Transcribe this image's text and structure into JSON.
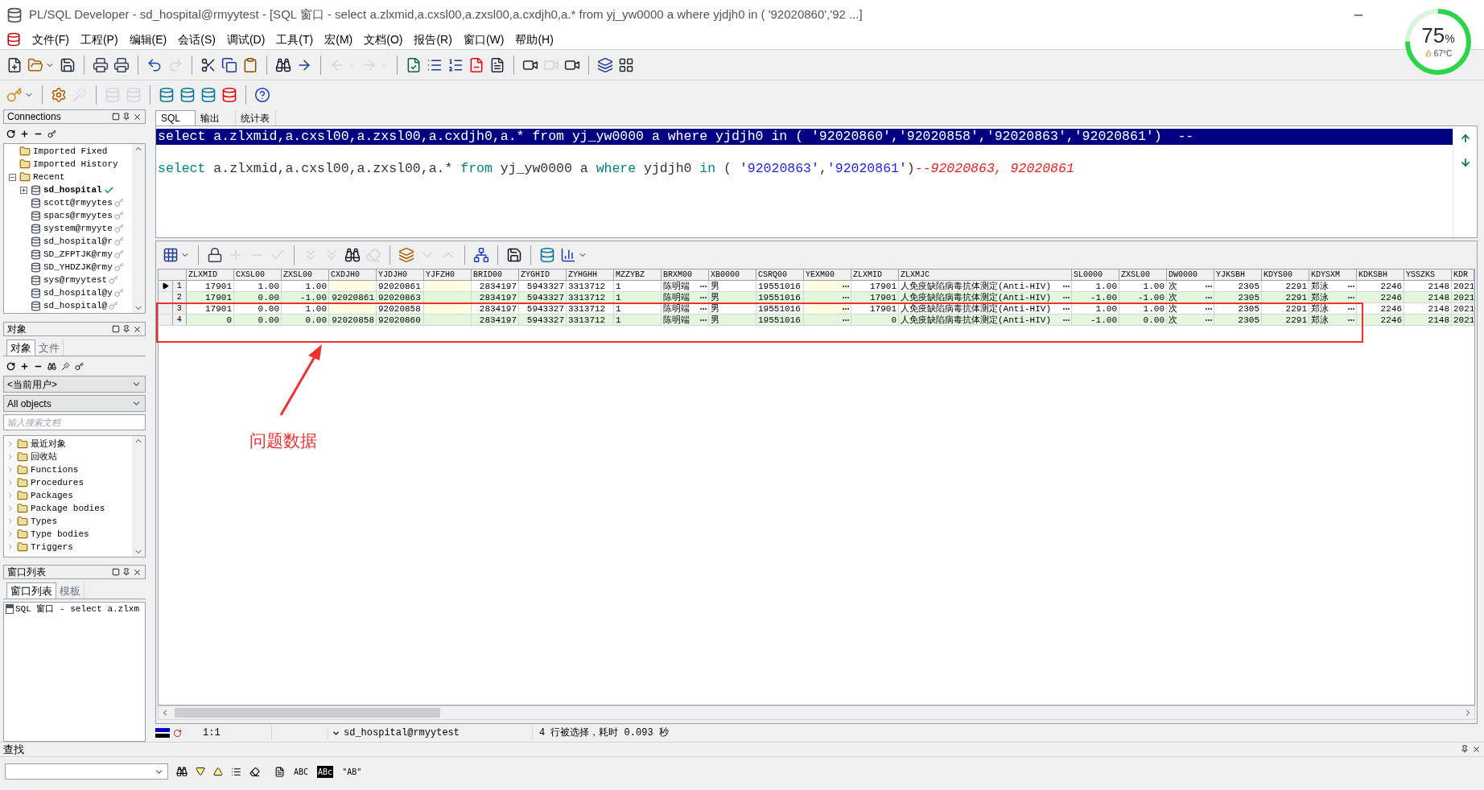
{
  "window": {
    "title": "PL/SQL Developer - sd_hospital@rmyytest - [SQL 窗口 - select a.zlxmid,a.cxsl00,a.zxsl00,a.cxdjh0,a.* from yj_yw0000 a where yjdjh0 in ( '92020860','92 ...]"
  },
  "menu": [
    "文件(F)",
    "工程(P)",
    "编辑(E)",
    "会话(S)",
    "调试(D)",
    "工具(T)",
    "宏(M)",
    "文档(O)",
    "报告(R)",
    "窗口(W)",
    "帮助(H)"
  ],
  "main_toolbar": [
    {
      "disabled": false
    },
    {
      "disabled": false
    },
    {
      "disabled": false
    },
    {
      "disabled": false
    },
    {
      "disabled": false
    },
    {
      "disabled": false
    },
    {
      "disabled": true
    },
    {
      "disabled": false
    },
    {
      "disabled": false
    },
    {
      "disabled": false
    },
    {
      "disabled": false
    },
    {
      "disabled": false
    },
    {
      "disabled": true
    },
    {
      "disabled": true
    },
    {
      "disabled": false
    },
    {
      "disabled": false
    },
    {
      "disabled": false
    },
    {
      "disabled": false
    },
    {
      "disabled": false
    },
    {
      "disabled": false
    },
    {
      "disabled": true
    },
    {
      "disabled": false
    },
    {
      "disabled": false
    },
    {
      "disabled": false
    }
  ],
  "session_toolbar": [
    {
      "disabled": false
    },
    {
      "disabled": false
    },
    {
      "disabled": true
    },
    {
      "disabled": true
    },
    {
      "disabled": true
    },
    {
      "disabled": false
    },
    {
      "disabled": false
    },
    {
      "disabled": false
    },
    {
      "disabled": false
    },
    {
      "disabled": false
    }
  ],
  "connections": {
    "title": "Connections",
    "items": [
      {
        "label": "Imported Fixed",
        "kind": "folder"
      },
      {
        "label": "Imported History",
        "kind": "folder"
      },
      {
        "label": "Recent",
        "kind": "folder",
        "expanded": true,
        "children": [
          {
            "label": "sd_hospital",
            "kind": "db",
            "active": true,
            "expanded": false
          },
          {
            "label": "scott@rmyytes",
            "kind": "db",
            "active": false
          },
          {
            "label": "spacs@rmyytes",
            "kind": "db",
            "active": false
          },
          {
            "label": "system@rmyyte",
            "kind": "db",
            "active": false
          },
          {
            "label": "sd_hospital@r",
            "kind": "db",
            "active": false
          },
          {
            "label": "SD_ZFPTJK@rmy",
            "kind": "db",
            "active": false
          },
          {
            "label": "SD_YHDZJK@rmy",
            "kind": "db",
            "active": false
          },
          {
            "label": "sys@rmyytest",
            "kind": "db",
            "active": false
          },
          {
            "label": "sd_hospital@y",
            "kind": "db",
            "active": false
          },
          {
            "label": "sd_hospital@",
            "kind": "db",
            "active": false
          }
        ]
      }
    ]
  },
  "objects": {
    "title": "对象",
    "tabs": [
      {
        "label": "对象",
        "selected": true
      },
      {
        "label": "文件",
        "selected": false
      }
    ],
    "user_select": "<当前用户>",
    "type_select": "All objects",
    "search": {
      "placeholder": "输入搜索文档"
    },
    "items": [
      "最近对象",
      "回收站",
      "Functions",
      "Procedures",
      "Packages",
      "Package bodies",
      "Types",
      "Type bodies",
      "Triggers"
    ]
  },
  "window_list": {
    "title": "窗口列表",
    "tabs": [
      {
        "label": "窗口列表",
        "selected": true
      },
      {
        "label": "模板",
        "selected": false
      }
    ],
    "items": [
      "SQL 窗口 - select a.zlxm"
    ]
  },
  "editor_tabs": [
    {
      "label": "SQL",
      "selected": true
    },
    {
      "label": "输出",
      "selected": false
    },
    {
      "label": "统计表",
      "selected": false
    }
  ],
  "editor_lines": [
    {
      "selected": true,
      "tokens": [
        {
          "text": "select a.zlxmid,a.cxsl00,a.zxsl00,a.cxdjh0,a.* from yj_yw0000 a where yjdjh0 in ( '92020860','92020858','92020863','92020861')  --"
        }
      ]
    },
    {
      "selected": false,
      "tokens": [
        {
          "text": "select",
          "kind": "keyword"
        },
        {
          "text": " a.zlxmid,a.cxsl00,a.zxsl00,a.* ",
          "kind": "plain"
        },
        {
          "text": "from",
          "kind": "keyword"
        },
        {
          "text": " yj_yw0000 a ",
          "kind": "plain"
        },
        {
          "text": "where",
          "kind": "keyword"
        },
        {
          "text": " yjdjh0 ",
          "kind": "plain"
        },
        {
          "text": "in",
          "kind": "keyword"
        },
        {
          "text": " ( ",
          "kind": "plain"
        },
        {
          "text": "'92020863'",
          "kind": "string"
        },
        {
          "text": ",",
          "kind": "plain"
        },
        {
          "text": "'92020861'",
          "kind": "string"
        },
        {
          "text": ")",
          "kind": "plain"
        },
        {
          "text": "--92020863, 92020861",
          "kind": "comment"
        }
      ]
    }
  ],
  "grid_toolbar": [
    {
      "disabled": false
    },
    {
      "disabled": false
    },
    {
      "disabled": true
    },
    {
      "disabled": true
    },
    {
      "disabled": true
    },
    {
      "disabled": true
    },
    {
      "disabled": true
    },
    {
      "disabled": false
    },
    {
      "disabled": true
    },
    {
      "disabled": false
    },
    {
      "disabled": true
    },
    {
      "disabled": true
    },
    {
      "disabled": false
    },
    {
      "disabled": false
    },
    {
      "disabled": false
    },
    {
      "disabled": false
    }
  ],
  "table": {
    "columns": [
      {
        "label": "ZLXMID",
        "numeric": true,
        "lookup": false
      },
      {
        "label": "CXSL00",
        "numeric": true,
        "lookup": false
      },
      {
        "label": "ZXSL00",
        "numeric": true,
        "lookup": false
      },
      {
        "label": "CXDJH0",
        "numeric": true,
        "lookup": false
      },
      {
        "label": "YJDJH0",
        "numeric": false
      },
      {
        "label": "YJFZH0",
        "lookup": false
      },
      {
        "label": "BRID00",
        "numeric": true,
        "lookup": false
      },
      {
        "label": "ZYGHID",
        "numeric": true,
        "lookup": false
      },
      {
        "label": "ZYHGHH",
        "numeric": false,
        "lookup": false
      },
      {
        "label": "MZZYBZ",
        "numeric": false,
        "lookup": false
      },
      {
        "label": "BRXM00",
        "numeric": false,
        "lookup": true
      },
      {
        "label": "XB0000",
        "numeric": false,
        "lookup": false
      },
      {
        "label": "CSRQ00",
        "numeric": false
      },
      {
        "label": "YEXM00",
        "lookup": true
      },
      {
        "label": "ZLXMID",
        "numeric": true,
        "lookup": false
      },
      {
        "label": "ZLXMJC",
        "numeric": false,
        "lookup": true
      },
      {
        "label": "SL0000",
        "numeric": true,
        "lookup": false
      },
      {
        "label": "ZXSL00",
        "numeric": true,
        "lookup": false
      },
      {
        "label": "DW0000",
        "numeric": false,
        "lookup": true
      },
      {
        "label": "YJKSBH",
        "numeric": true,
        "lookup": false
      },
      {
        "label": "KDYS00",
        "numeric": true,
        "lookup": false
      },
      {
        "label": "KDYSXM",
        "numeric": false,
        "lookup": true
      },
      {
        "label": "KDKSBH",
        "numeric": true,
        "lookup": false
      },
      {
        "label": "YSSZKS",
        "numeric": true,
        "lookup": false
      },
      {
        "label": "KDR"
      }
    ],
    "rows": [
      {
        "number": "1",
        "current": true,
        "cells": [
          "17901",
          "1.00",
          "1.00",
          null,
          "92020861",
          null,
          "2834197",
          "5943327",
          "3313712",
          "1",
          "陈明端",
          "男",
          "19551016",
          null,
          "17901",
          "人免疫缺陷病毒抗体测定(Anti-HIV)",
          "1.00",
          "1.00",
          "次",
          "2305",
          "2291",
          "郑泳",
          "2246",
          "2148",
          "2021"
        ]
      },
      {
        "number": "2",
        "current": false,
        "cells": [
          "17901",
          "0.00",
          "-1.00",
          "92020861",
          "92020863",
          null,
          "2834197",
          "5943327",
          "3313712",
          "1",
          "陈明端",
          "男",
          "19551016",
          null,
          "17901",
          "人免疫缺陷病毒抗体测定(Anti-HIV)",
          "-1.00",
          "-1.00",
          "次",
          "2305",
          "2291",
          "郑泳",
          "2246",
          "2148",
          "2021"
        ]
      },
      {
        "number": "3",
        "current": false,
        "cells": [
          "17901",
          "0.00",
          "1.00",
          null,
          "92020858",
          null,
          "2834197",
          "5943327",
          "3313712",
          "1",
          "陈明端",
          "男",
          "19551016",
          null,
          "17901",
          "人免疫缺陷病毒抗体测定(Anti-HIV)",
          "1.00",
          "1.00",
          "次",
          "2305",
          "2291",
          "郑泳",
          "2246",
          "2148",
          "2021"
        ]
      },
      {
        "number": "4",
        "current": false,
        "cells": [
          "0",
          "0.00",
          "0.00",
          "92020858",
          "92020860",
          null,
          "2834197",
          "5943327",
          "3313712",
          "1",
          "陈明端",
          "男",
          "19551016",
          null,
          "0",
          "人免疫缺陷病毒抗体测定(Anti-HIV)",
          "-1.00",
          "0.00",
          "次",
          "2305",
          "2291",
          "郑泳",
          "2246",
          "2148",
          "2021"
        ]
      }
    ]
  },
  "status_bar": {
    "position": "1:1",
    "connection": "sd_hospital@rmyytest",
    "message": "4 行被选择，耗时 0.093 秒"
  },
  "find": {
    "title": "查找",
    "options": [
      "ABC",
      "ABc",
      "\"AB\""
    ]
  },
  "annotation": {
    "label": "问题数据"
  },
  "cpu_widget": {
    "load": "75",
    "unit": "%",
    "temperature": "67°C",
    "level": 0.75
  }
}
